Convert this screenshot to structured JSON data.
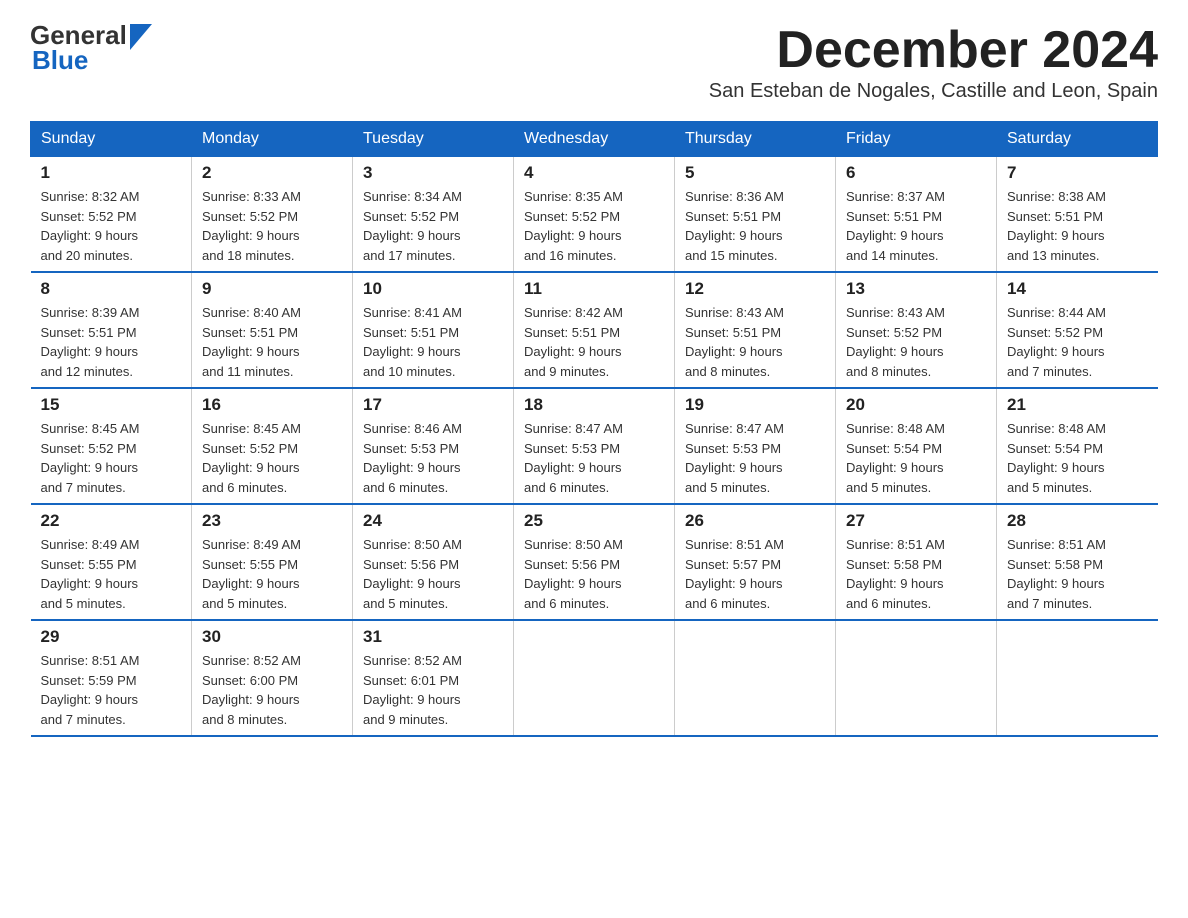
{
  "header": {
    "logo_general": "General",
    "logo_blue": "Blue",
    "month_title": "December 2024",
    "subtitle": "San Esteban de Nogales, Castille and Leon, Spain"
  },
  "calendar": {
    "days_of_week": [
      "Sunday",
      "Monday",
      "Tuesday",
      "Wednesday",
      "Thursday",
      "Friday",
      "Saturday"
    ],
    "weeks": [
      [
        {
          "day": "1",
          "info": "Sunrise: 8:32 AM\nSunset: 5:52 PM\nDaylight: 9 hours\nand 20 minutes."
        },
        {
          "day": "2",
          "info": "Sunrise: 8:33 AM\nSunset: 5:52 PM\nDaylight: 9 hours\nand 18 minutes."
        },
        {
          "day": "3",
          "info": "Sunrise: 8:34 AM\nSunset: 5:52 PM\nDaylight: 9 hours\nand 17 minutes."
        },
        {
          "day": "4",
          "info": "Sunrise: 8:35 AM\nSunset: 5:52 PM\nDaylight: 9 hours\nand 16 minutes."
        },
        {
          "day": "5",
          "info": "Sunrise: 8:36 AM\nSunset: 5:51 PM\nDaylight: 9 hours\nand 15 minutes."
        },
        {
          "day": "6",
          "info": "Sunrise: 8:37 AM\nSunset: 5:51 PM\nDaylight: 9 hours\nand 14 minutes."
        },
        {
          "day": "7",
          "info": "Sunrise: 8:38 AM\nSunset: 5:51 PM\nDaylight: 9 hours\nand 13 minutes."
        }
      ],
      [
        {
          "day": "8",
          "info": "Sunrise: 8:39 AM\nSunset: 5:51 PM\nDaylight: 9 hours\nand 12 minutes."
        },
        {
          "day": "9",
          "info": "Sunrise: 8:40 AM\nSunset: 5:51 PM\nDaylight: 9 hours\nand 11 minutes."
        },
        {
          "day": "10",
          "info": "Sunrise: 8:41 AM\nSunset: 5:51 PM\nDaylight: 9 hours\nand 10 minutes."
        },
        {
          "day": "11",
          "info": "Sunrise: 8:42 AM\nSunset: 5:51 PM\nDaylight: 9 hours\nand 9 minutes."
        },
        {
          "day": "12",
          "info": "Sunrise: 8:43 AM\nSunset: 5:51 PM\nDaylight: 9 hours\nand 8 minutes."
        },
        {
          "day": "13",
          "info": "Sunrise: 8:43 AM\nSunset: 5:52 PM\nDaylight: 9 hours\nand 8 minutes."
        },
        {
          "day": "14",
          "info": "Sunrise: 8:44 AM\nSunset: 5:52 PM\nDaylight: 9 hours\nand 7 minutes."
        }
      ],
      [
        {
          "day": "15",
          "info": "Sunrise: 8:45 AM\nSunset: 5:52 PM\nDaylight: 9 hours\nand 7 minutes."
        },
        {
          "day": "16",
          "info": "Sunrise: 8:45 AM\nSunset: 5:52 PM\nDaylight: 9 hours\nand 6 minutes."
        },
        {
          "day": "17",
          "info": "Sunrise: 8:46 AM\nSunset: 5:53 PM\nDaylight: 9 hours\nand 6 minutes."
        },
        {
          "day": "18",
          "info": "Sunrise: 8:47 AM\nSunset: 5:53 PM\nDaylight: 9 hours\nand 6 minutes."
        },
        {
          "day": "19",
          "info": "Sunrise: 8:47 AM\nSunset: 5:53 PM\nDaylight: 9 hours\nand 5 minutes."
        },
        {
          "day": "20",
          "info": "Sunrise: 8:48 AM\nSunset: 5:54 PM\nDaylight: 9 hours\nand 5 minutes."
        },
        {
          "day": "21",
          "info": "Sunrise: 8:48 AM\nSunset: 5:54 PM\nDaylight: 9 hours\nand 5 minutes."
        }
      ],
      [
        {
          "day": "22",
          "info": "Sunrise: 8:49 AM\nSunset: 5:55 PM\nDaylight: 9 hours\nand 5 minutes."
        },
        {
          "day": "23",
          "info": "Sunrise: 8:49 AM\nSunset: 5:55 PM\nDaylight: 9 hours\nand 5 minutes."
        },
        {
          "day": "24",
          "info": "Sunrise: 8:50 AM\nSunset: 5:56 PM\nDaylight: 9 hours\nand 5 minutes."
        },
        {
          "day": "25",
          "info": "Sunrise: 8:50 AM\nSunset: 5:56 PM\nDaylight: 9 hours\nand 6 minutes."
        },
        {
          "day": "26",
          "info": "Sunrise: 8:51 AM\nSunset: 5:57 PM\nDaylight: 9 hours\nand 6 minutes."
        },
        {
          "day": "27",
          "info": "Sunrise: 8:51 AM\nSunset: 5:58 PM\nDaylight: 9 hours\nand 6 minutes."
        },
        {
          "day": "28",
          "info": "Sunrise: 8:51 AM\nSunset: 5:58 PM\nDaylight: 9 hours\nand 7 minutes."
        }
      ],
      [
        {
          "day": "29",
          "info": "Sunrise: 8:51 AM\nSunset: 5:59 PM\nDaylight: 9 hours\nand 7 minutes."
        },
        {
          "day": "30",
          "info": "Sunrise: 8:52 AM\nSunset: 6:00 PM\nDaylight: 9 hours\nand 8 minutes."
        },
        {
          "day": "31",
          "info": "Sunrise: 8:52 AM\nSunset: 6:01 PM\nDaylight: 9 hours\nand 9 minutes."
        },
        {
          "day": "",
          "info": ""
        },
        {
          "day": "",
          "info": ""
        },
        {
          "day": "",
          "info": ""
        },
        {
          "day": "",
          "info": ""
        }
      ]
    ]
  }
}
